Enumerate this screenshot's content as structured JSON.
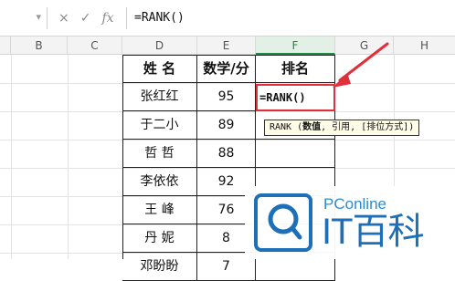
{
  "formula_bar": {
    "name_box_value": "",
    "cancel_icon": "×",
    "confirm_icon": "✓",
    "fx_label": "fx",
    "formula": "=RANK()"
  },
  "columns": [
    "B",
    "C",
    "D",
    "E",
    "F",
    "G",
    "H"
  ],
  "active_column": "F",
  "table": {
    "headers": [
      "姓  名",
      "数学/分",
      "排名"
    ],
    "rows": [
      [
        "张红红",
        "95",
        ""
      ],
      [
        "于二小",
        "89",
        ""
      ],
      [
        "哲   哲",
        "88",
        ""
      ],
      [
        "李依依",
        "92",
        ""
      ],
      [
        "王   峰",
        "76",
        ""
      ],
      [
        "丹   妮",
        "8",
        ""
      ],
      [
        "邓盼盼",
        "7",
        ""
      ]
    ]
  },
  "active_cell": {
    "text": "=RANK()"
  },
  "tooltip": {
    "func": "RANK (",
    "arg1": "数值",
    "rest": ", 引用, [排位方式])"
  },
  "annotation_color": "#e0303a",
  "accent_color": "#1f8a43",
  "watermark": {
    "small_text": "PConline",
    "big_text": "IT百科"
  }
}
